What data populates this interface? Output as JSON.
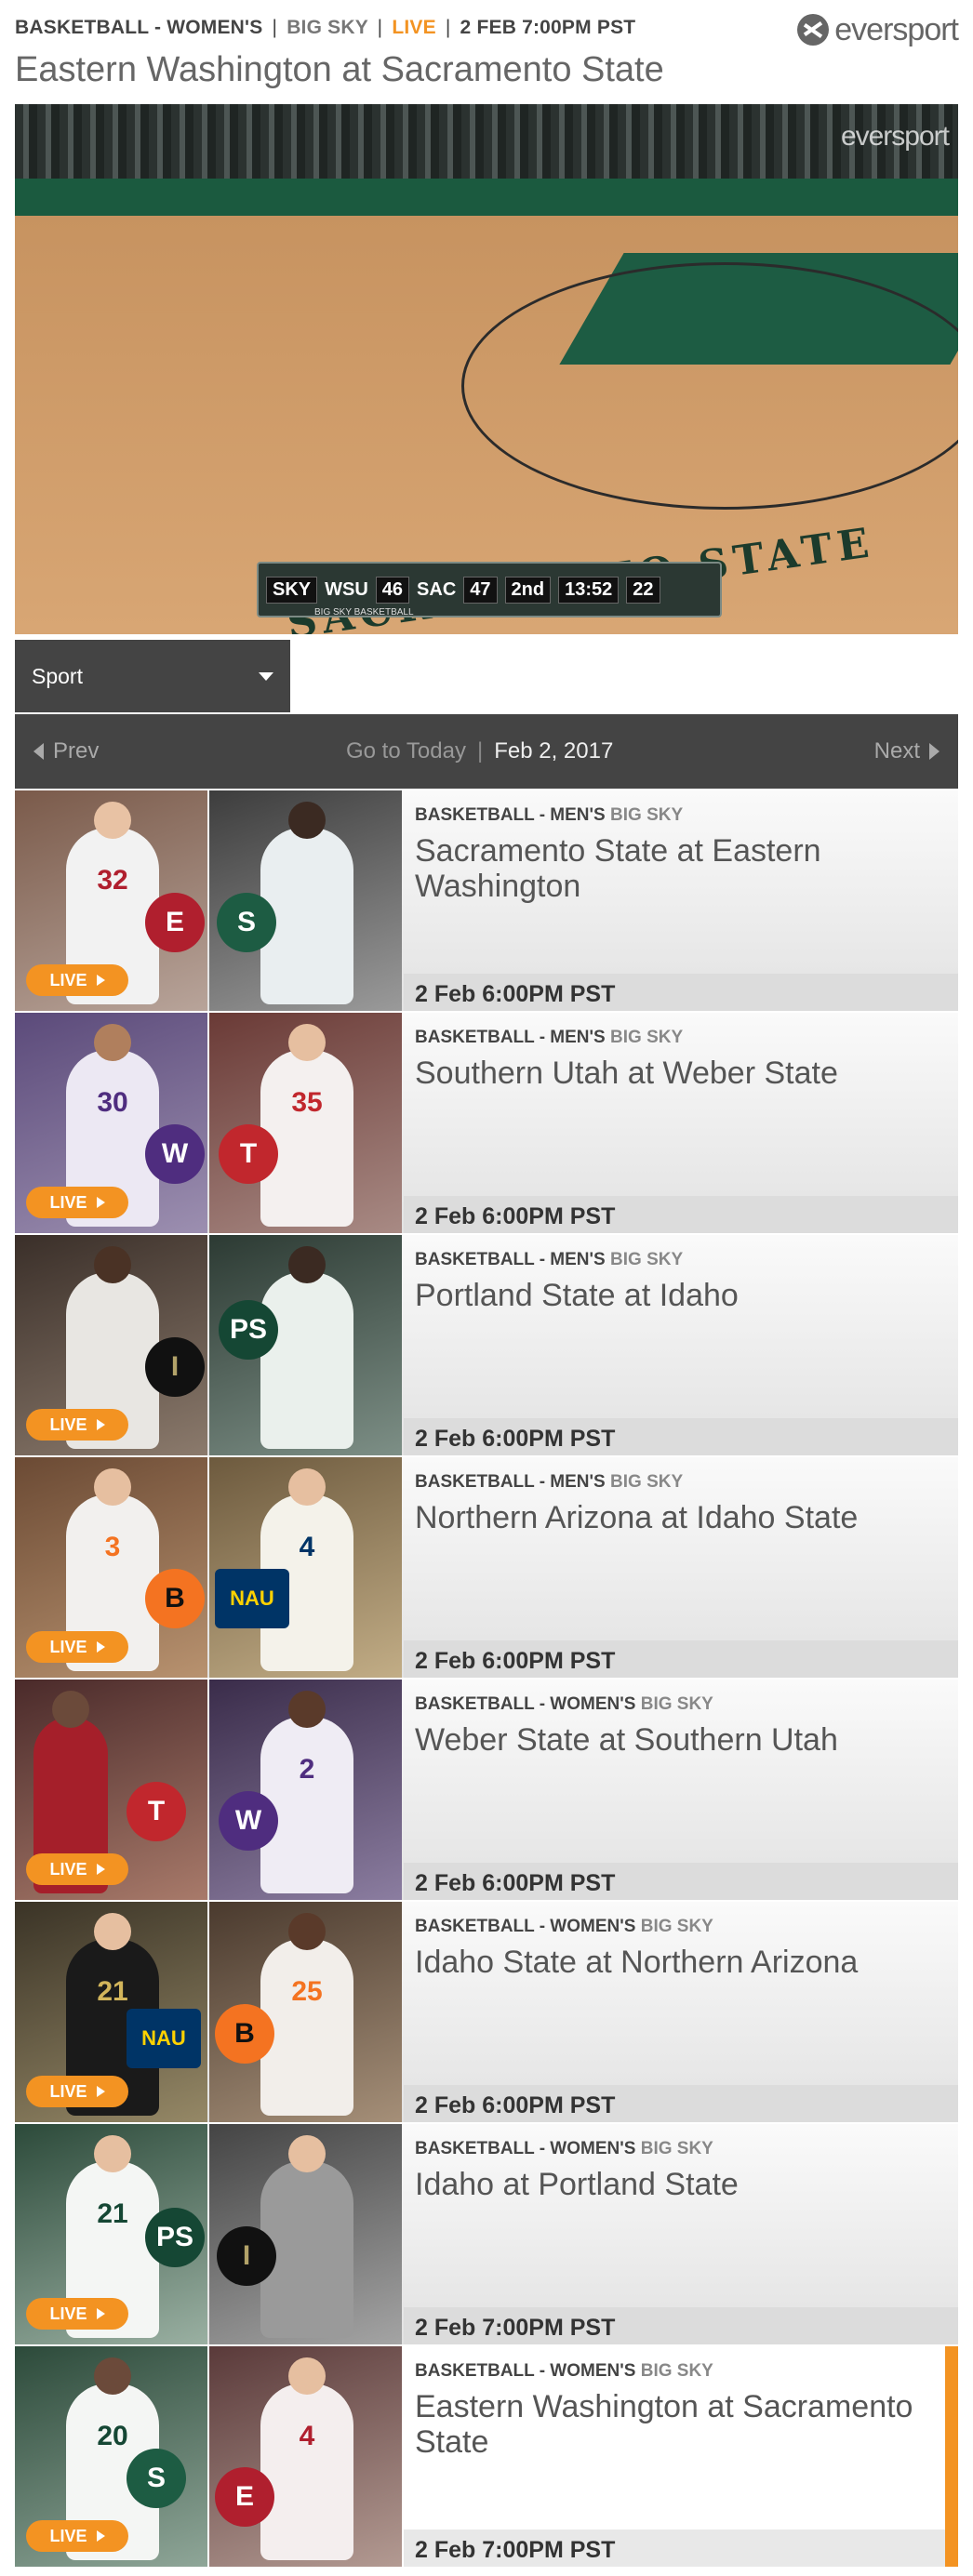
{
  "header": {
    "sport": "BASKETBALL - WOMEN'S",
    "sep1": "|",
    "conference": "BIG SKY",
    "sep2": "|",
    "status": "LIVE",
    "sep3": "|",
    "datetime": "2 FEB 7:00PM PST",
    "logo": "eversport",
    "title": "Eastern Washington at Sacramento State"
  },
  "video": {
    "watermark": "eversport",
    "court_text": "SACRAMENTO STATE",
    "scorebug": {
      "network": "SKY",
      "away_team": "WSU",
      "away_score": "46",
      "home_team": "SAC",
      "home_score": "47",
      "period": "2nd",
      "clock": "13:52",
      "shot_clock": "22",
      "caption": "BIG SKY BASKETBALL"
    }
  },
  "filter": {
    "sport_label": "Sport",
    "icon": "chevron-down-icon"
  },
  "datebar": {
    "prev": "Prev",
    "go_to_today": "Go to Today",
    "divider": "|",
    "date": "Feb 2, 2017",
    "next": "Next"
  },
  "live_label": "LIVE",
  "colors": {
    "accent": "#f39322",
    "bar": "#444444"
  },
  "games": [
    {
      "cat": "BASKETBALL - MEN'S",
      "conf": "BIG SKY",
      "title": "Sacramento State at Eastern Washington",
      "time": "2 Feb 6:00PM PST"
    },
    {
      "cat": "BASKETBALL - MEN'S",
      "conf": "BIG SKY",
      "title": "Southern Utah at Weber State",
      "time": "2 Feb 6:00PM PST"
    },
    {
      "cat": "BASKETBALL - MEN'S",
      "conf": "BIG SKY",
      "title": "Portland State at Idaho",
      "time": "2 Feb 6:00PM PST"
    },
    {
      "cat": "BASKETBALL - MEN'S",
      "conf": "BIG SKY",
      "title": "Northern Arizona at Idaho State",
      "time": "2 Feb 6:00PM PST"
    },
    {
      "cat": "BASKETBALL - WOMEN'S",
      "conf": "BIG SKY",
      "title": "Weber State at Southern Utah",
      "time": "2 Feb 6:00PM PST"
    },
    {
      "cat": "BASKETBALL - WOMEN'S",
      "conf": "BIG SKY",
      "title": "Idaho State at Northern Arizona",
      "time": "2 Feb 6:00PM PST"
    },
    {
      "cat": "BASKETBALL - WOMEN'S",
      "conf": "BIG SKY",
      "title": "Idaho at Portland State",
      "time": "2 Feb 7:00PM PST"
    },
    {
      "cat": "BASKETBALL - WOMEN'S",
      "conf": "BIG SKY",
      "title": "Eastern Washington at Sacramento State",
      "time": "2 Feb 7:00PM PST"
    }
  ]
}
